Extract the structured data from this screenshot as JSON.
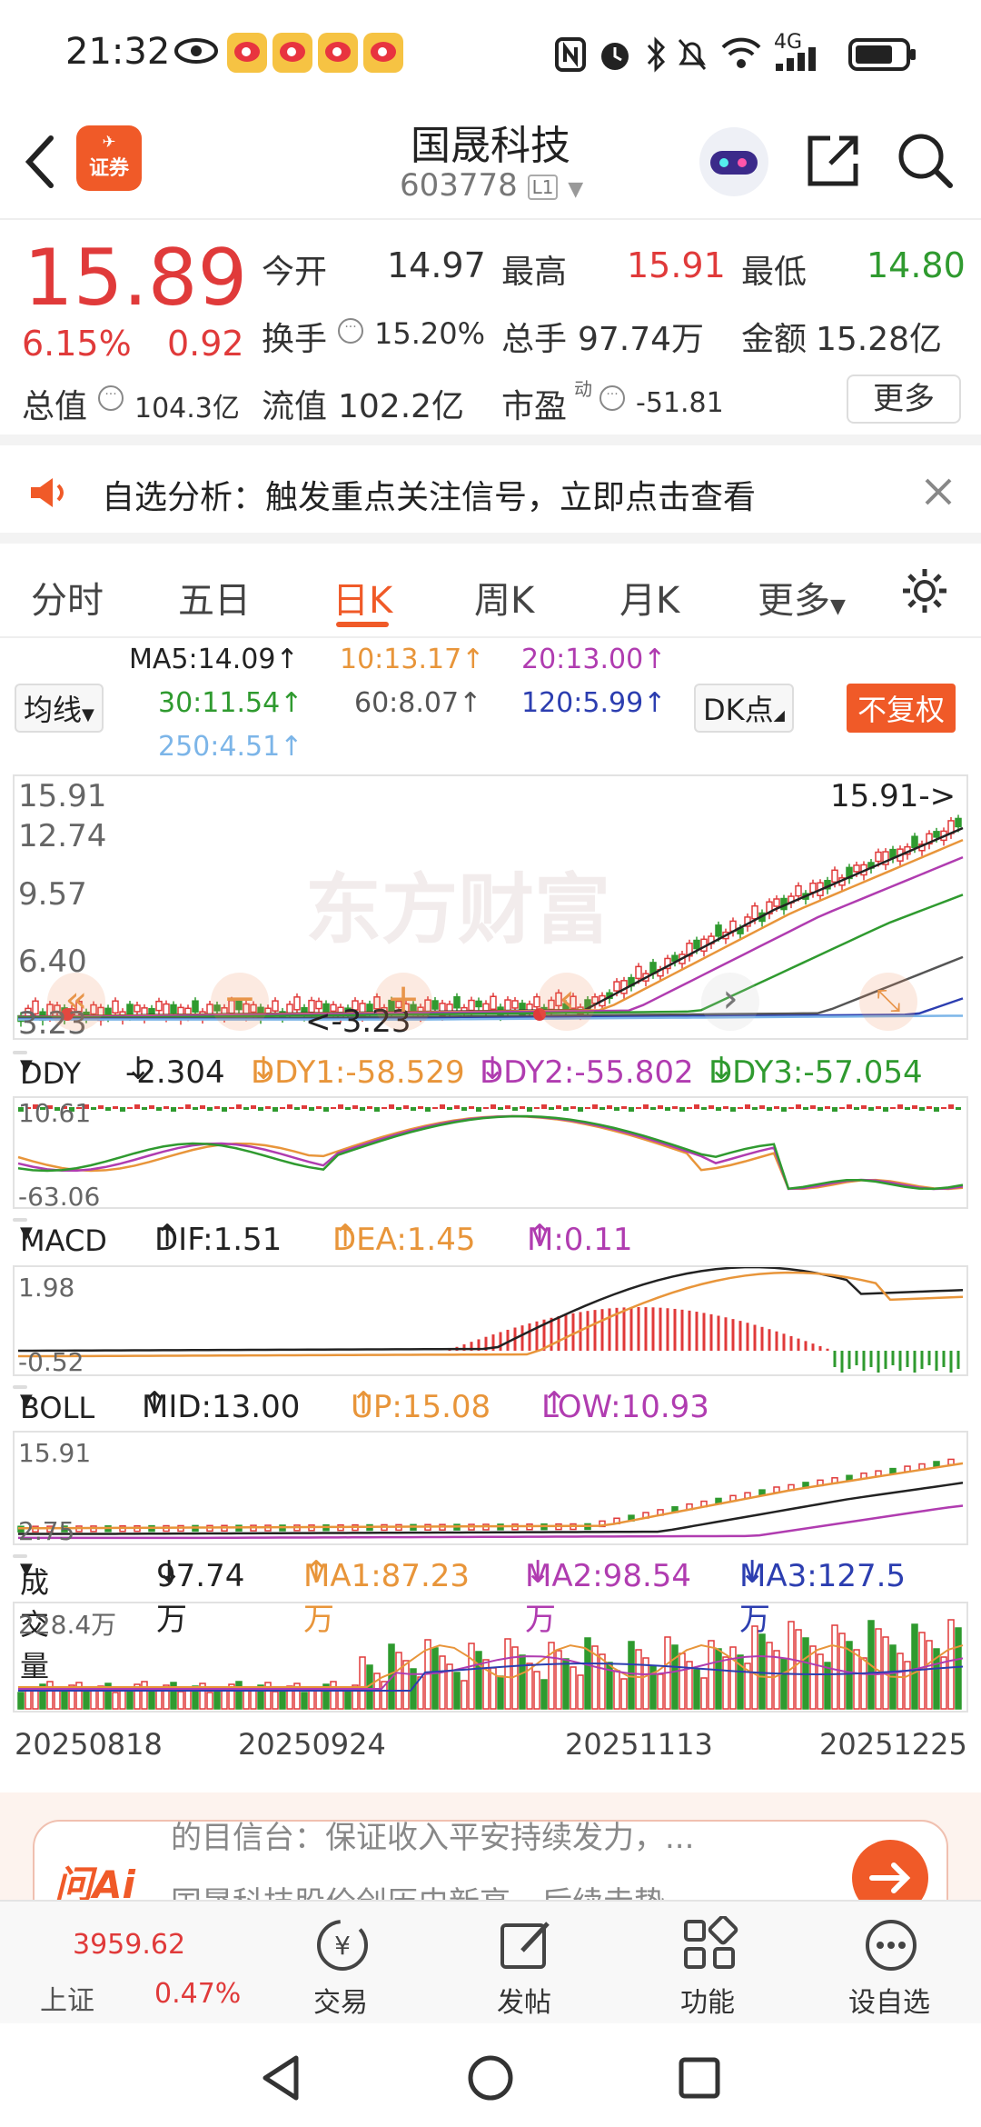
{
  "status": {
    "time": "21:32",
    "network": "4G"
  },
  "header": {
    "logo": "证券",
    "name": "国晟科技",
    "code": "603778",
    "badge": "L1"
  },
  "quote": {
    "price": "15.89",
    "change_pct": "6.15%",
    "change": "0.92",
    "open_label": "今开",
    "open": "14.97",
    "high_label": "最高",
    "high": "15.91",
    "low_label": "最低",
    "low": "14.80",
    "turnover_label": "换手",
    "turnover": "15.20%",
    "volume_label": "总手",
    "volume": "97.74万",
    "amount_label": "金额",
    "amount": "15.28亿",
    "mktcap_label": "总值",
    "mktcap": "104.3亿",
    "float_label": "流值",
    "float": "102.2亿",
    "pe_label": "市盈",
    "pe_sup": "动",
    "pe": "-51.81",
    "more": "更多"
  },
  "alert": {
    "text": "自选分析：触发重点关注信号，立即点击查看"
  },
  "tabs": [
    "分时",
    "五日",
    "日K",
    "周K",
    "月K",
    "更多"
  ],
  "ma": {
    "selector": "均线",
    "ma5": "MA5:14.09",
    "ma10": "10:13.17",
    "ma20": "20:13.00",
    "ma30": "30:11.54",
    "ma60": "60:8.07",
    "ma120": "120:5.99",
    "ma250": "250:4.51",
    "dk": "DK点",
    "fq": "不复权"
  },
  "kline": {
    "y1": "15.91",
    "y2": "12.74",
    "y3": "9.57",
    "y4": "6.40",
    "y5": "3.23",
    "max_tag": "15.91->",
    "min_tag": "<-3.23"
  },
  "ddy": {
    "selector": "DDY",
    "ddy": "-2.304",
    "ddy1": "DDY1:-58.529",
    "ddy2": "DDY2:-55.802",
    "ddy3": "DDY3:-57.054",
    "ymax": "10.61",
    "ymin": "-63.06"
  },
  "macd": {
    "selector": "MACD",
    "dif": "DIF:1.51",
    "dea": "DEA:1.45",
    "m": "M:0.11",
    "ymax": "1.98",
    "ymin": "-0.52"
  },
  "boll": {
    "selector": "BOLL",
    "mid": "MID:13.00",
    "up": "UP:15.08",
    "low": "LOW:10.93",
    "ymax": "15.91",
    "ymin": "2.75"
  },
  "vol": {
    "selector": "成交量",
    "vol": "97.74万",
    "ma1": "MA1:87.23万",
    "ma2": "MA2:98.54万",
    "ma3": "MA3:127.5万",
    "ymax": "228.4万"
  },
  "dates": [
    "20250818",
    "20250924",
    "20251113",
    "20251225"
  ],
  "ai": {
    "logo": "问Ai",
    "line1": "的目信台：保证收入平安持续发力，...",
    "line2": "国晟科技股价创历史新高，后续走势..."
  },
  "index": {
    "value": "3959.62",
    "name": "上证",
    "pct": "0.47%"
  },
  "nav": [
    "交易",
    "发帖",
    "功能",
    "设自选"
  ],
  "colors": {
    "up": "#e03a3a",
    "down": "#2f9a2f",
    "accent": "#f05a28"
  }
}
